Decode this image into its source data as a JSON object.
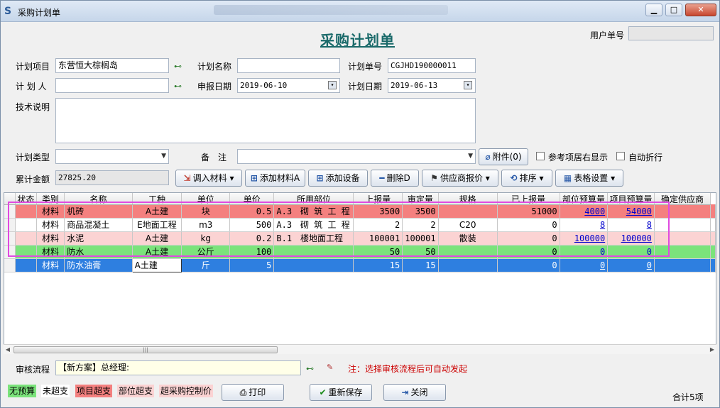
{
  "window": {
    "title": "采购计划单",
    "app_icon": "app-logo-icon",
    "controls": [
      "minimize-icon",
      "maximize-icon",
      "close-icon"
    ]
  },
  "heading": "采购计划单",
  "user_doc_no": {
    "label": "用户单号",
    "value": ""
  },
  "form": {
    "project": {
      "label": "计划项目",
      "value": "东营恒大棕榈岛"
    },
    "plan_name": {
      "label": "计划名称",
      "value": ""
    },
    "plan_no": {
      "label": "计划单号",
      "value": "CGJHD190000011"
    },
    "planner": {
      "label": "计 划 人",
      "value": ""
    },
    "report_date": {
      "label": "申报日期",
      "value": "2019-06-10"
    },
    "plan_date": {
      "label": "计划日期",
      "value": "2019-06-13"
    },
    "tech_desc": {
      "label": "技术说明",
      "value": ""
    },
    "plan_type": {
      "label": "计划类型",
      "value": ""
    },
    "remark": {
      "label": "备　注",
      "value": ""
    },
    "total": {
      "label": "累计金额",
      "value": "27825.20"
    }
  },
  "buttons": {
    "attachment": "附件(0)",
    "ref_right": "参考项居右显示",
    "auto_wrap": "自动折行",
    "import_material": "调入材料",
    "add_material": "添加材料A",
    "add_equipment": "添加设备",
    "delete": "删除D",
    "supplier_quote": "供应商报价",
    "sort": "排序",
    "table_settings": "表格设置",
    "print": "打印",
    "resave": "重新保存",
    "close": "关闭"
  },
  "table": {
    "columns": [
      "状态",
      "类别",
      "名称",
      "工种",
      "单位",
      "单价",
      "所用部位",
      "上报量",
      "审定量",
      "规格",
      "已上报量",
      "部位预算量",
      "项目预算量",
      "确定供应商"
    ],
    "rows": [
      {
        "style": "red",
        "status": "",
        "category": "材料",
        "name": "机砖",
        "trade": "A土建",
        "unit": "块",
        "price": "0.5",
        "location": "A.3　砌 筑 工 程",
        "reported": "3500",
        "approved": "3500",
        "spec": "",
        "already": "51000",
        "part_budget": "4000",
        "proj_budget": "54000",
        "supplier": ""
      },
      {
        "style": "white",
        "status": "",
        "category": "材料",
        "name": "商品混凝土",
        "trade": "E地面工程",
        "unit": "m3",
        "price": "500",
        "location": "A.3　砌 筑 工 程",
        "reported": "2",
        "approved": "2",
        "spec": "C20",
        "already": "0",
        "part_budget": "8",
        "proj_budget": "8",
        "supplier": ""
      },
      {
        "style": "pink",
        "status": "",
        "category": "材料",
        "name": "水泥",
        "trade": "A土建",
        "unit": "kg",
        "price": "0.2",
        "location": "B.1　楼地面工程",
        "reported": "100001",
        "approved": "100001",
        "spec": "散装",
        "already": "0",
        "part_budget": "100000",
        "proj_budget": "100000",
        "supplier": ""
      },
      {
        "style": "green",
        "status": "",
        "category": "材料",
        "name": "防水",
        "trade": "A土建",
        "unit": "公斤",
        "price": "100",
        "location": "",
        "reported": "50",
        "approved": "50",
        "spec": "",
        "already": "0",
        "part_budget": "0",
        "proj_budget": "0",
        "supplier": ""
      },
      {
        "style": "blue",
        "status": "",
        "category": "材料",
        "name": "防水油膏",
        "trade": "A土建",
        "unit": "斤",
        "price": "5",
        "location": "",
        "reported": "15",
        "approved": "15",
        "spec": "",
        "already": "0",
        "part_budget": "0",
        "proj_budget": "0",
        "supplier": ""
      }
    ]
  },
  "audit": {
    "label": "审核流程",
    "value": "【新方案】总经理:",
    "note": "注：选择审核流程后可自动发起"
  },
  "legend": [
    {
      "text": "无预算",
      "color": "#7be37b"
    },
    {
      "text": "未超支",
      "color": "#ffffff"
    },
    {
      "text": "项目超支",
      "color": "#f4807f"
    },
    {
      "text": "部位超支",
      "color": "#fbd3d3"
    },
    {
      "text": "超采购控制价",
      "color": "#fbd3d3"
    }
  ],
  "footer": {
    "count": "合计5项"
  }
}
